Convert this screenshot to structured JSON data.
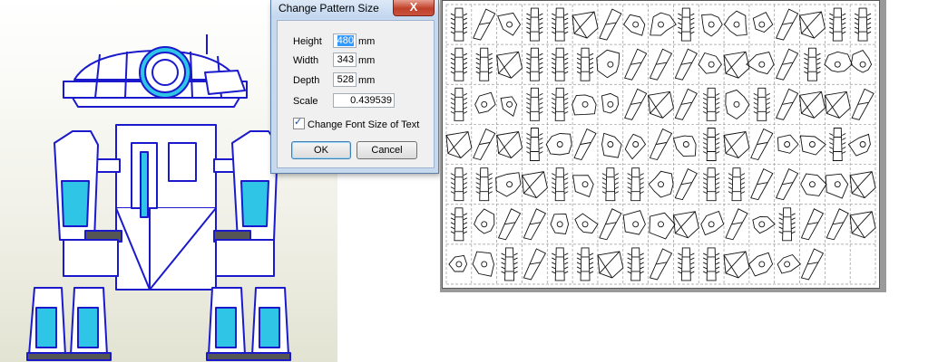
{
  "dialog": {
    "title": "Change Pattern Size",
    "close_glyph": "X",
    "fields": {
      "height": {
        "label": "Height",
        "value": "480",
        "unit": "mm"
      },
      "width": {
        "label": "Width",
        "value": "343",
        "unit": "mm"
      },
      "depth": {
        "label": "Depth",
        "value": "528",
        "unit": "mm"
      },
      "scale": {
        "label": "Scale",
        "value": "0.439539"
      }
    },
    "checkbox": {
      "label": "Change Font Size of Text",
      "checked": true
    },
    "ok_label": "OK",
    "cancel_label": "Cancel"
  },
  "viewport": {
    "model": "robot-3d-model",
    "colors": {
      "edge": "#1a1acc",
      "face": "#ffffff",
      "accent": "#2ec5e6",
      "dark": "#555555"
    }
  },
  "pattern_sheet": {
    "grid": {
      "columns": 17,
      "rows": 7
    },
    "border_color": "#555555"
  }
}
